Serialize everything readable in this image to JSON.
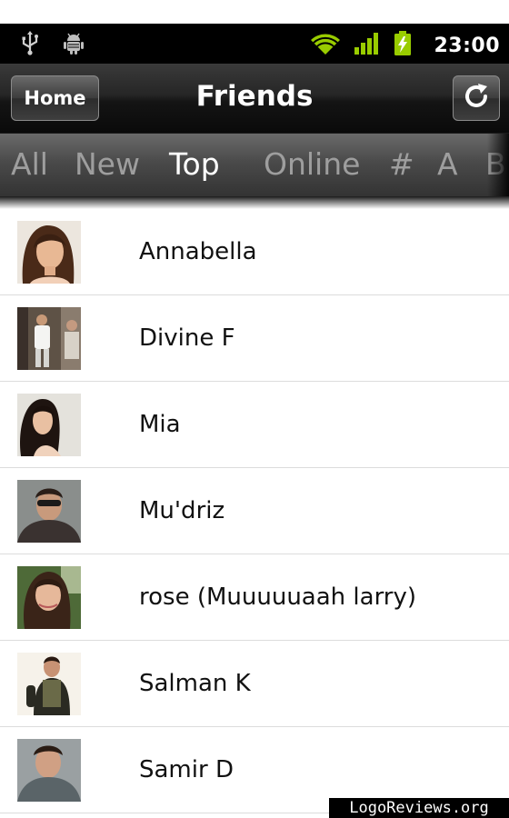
{
  "status_bar": {
    "left_icons": [
      "usb-icon",
      "android-debug-icon"
    ],
    "right_icons": [
      "wifi-icon",
      "signal-icon",
      "battery-charging-icon"
    ],
    "time": "23:00",
    "accent_color": "#99cc00"
  },
  "header": {
    "home_label": "Home",
    "title": "Friends",
    "refresh_icon": "refresh-icon"
  },
  "tabs": [
    {
      "label": "All"
    },
    {
      "label": "New"
    },
    {
      "label": "Top",
      "selected": true
    },
    {
      "label": "Online"
    },
    {
      "label": "#"
    },
    {
      "label": "A"
    },
    {
      "label": "B"
    }
  ],
  "friends": [
    {
      "name": "Annabella"
    },
    {
      "name": "Divine F"
    },
    {
      "name": "Mia"
    },
    {
      "name": "Mu'driz"
    },
    {
      "name": "rose (Muuuuuaah larry)"
    },
    {
      "name": "Salman K"
    },
    {
      "name": "Samir D"
    }
  ],
  "watermark": "LogoReviews.org"
}
